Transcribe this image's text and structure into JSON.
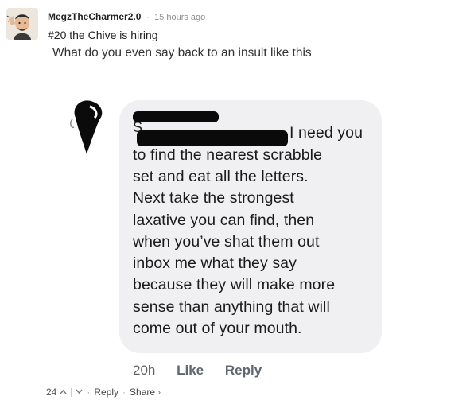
{
  "comment": {
    "author": "MegzTheCharmer2.0",
    "separator": "·",
    "timestamp": "15 hours ago",
    "post_title": "#20 the Chive is hiring",
    "body": "What do you even say back to an insult like this"
  },
  "screenshot": {
    "redacted_initial": "S",
    "message_lines": [
      "I need you",
      "to find the nearest scrabble",
      "set and eat all the letters.",
      "Next take the strongest",
      "laxative you can find, then",
      "when you’ve shat them out",
      "inbox me what they say",
      "because they will make more",
      "sense than anything that will",
      "come out of your mouth."
    ],
    "time": "20h",
    "like_label": "Like",
    "reply_label": "Reply"
  },
  "footer": {
    "vote_count": "24",
    "upvote_icon": "chevron-up-icon",
    "downvote_icon": "chevron-down-icon",
    "dot": "·",
    "reply_label": "Reply",
    "share_label": "Share",
    "share_arrow": "›"
  }
}
